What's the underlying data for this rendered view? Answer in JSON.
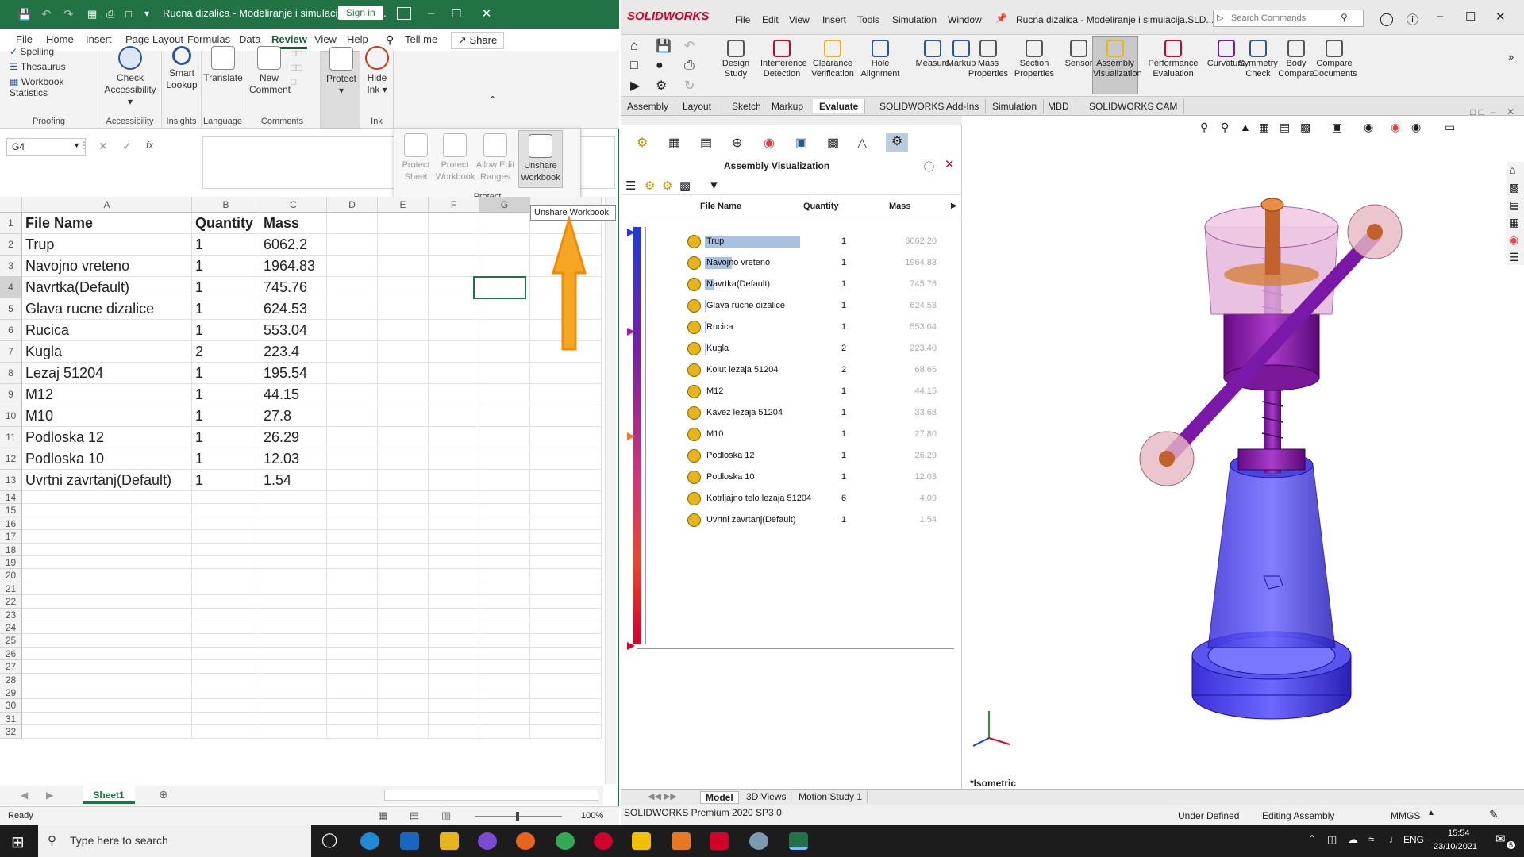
{
  "excel": {
    "title": "Ruсna dizalica - Modeliranje i simulacija_1.xlsx...",
    "signin_label": "Sign in",
    "tabs": [
      "File",
      "Home",
      "Insert",
      "Page Layout",
      "Formulas",
      "Data",
      "Review",
      "View",
      "Help"
    ],
    "tell_me": "Tell me",
    "share_label": "Share",
    "ribbon": {
      "proofing": {
        "spelling": "Spelling",
        "thesaurus": "Thesaurus",
        "stats": "Workbook Statistics",
        "group": "Proofing"
      },
      "accessibility": {
        "button": "Check Accessibility",
        "group": "Accessibility"
      },
      "insights": {
        "button": "Smart Lookup",
        "group": "Insights"
      },
      "language": {
        "button": "Translate",
        "group": "Language"
      },
      "comments": {
        "button": "New Comment",
        "group": "Comments"
      },
      "protect": {
        "button": "Protect",
        "group": "Protect"
      },
      "ink": {
        "button": "Hide Ink",
        "group": "Ink"
      }
    },
    "protect_popup": {
      "protect_sheet": "Protect Sheet",
      "protect_workbook": "Protect Workbook",
      "allow_edit": "Allow Edit Ranges",
      "unshare": "Unshare Workbook",
      "group": "Protect"
    },
    "tooltip": "Unshare Workbook",
    "namebox": "G4",
    "fx": "fx",
    "columns": [
      "A",
      "B",
      "C",
      "D",
      "E",
      "F",
      "G"
    ],
    "rows": [
      [
        "File Name",
        "Quantity",
        "Mass"
      ],
      [
        "Trup",
        "1",
        "6062.2"
      ],
      [
        "Navojno vreteno",
        "1",
        "1964.83"
      ],
      [
        "Navrtka(Default)",
        "1",
        "745.76"
      ],
      [
        "Glava rucne dizalice",
        "1",
        "624.53"
      ],
      [
        "Rucica",
        "1",
        "553.04"
      ],
      [
        "Kugla",
        "2",
        "223.4"
      ],
      [
        "Lezaj 51204",
        "1",
        "195.54"
      ],
      [
        "M12",
        "1",
        "44.15"
      ],
      [
        "M10",
        "1",
        "27.8"
      ],
      [
        "Podloska 12",
        "1",
        "26.29"
      ],
      [
        "Podloska 10",
        "1",
        "12.03"
      ],
      [
        "Uvrtni zavrtanj(Default)",
        "1",
        "1.54"
      ]
    ],
    "row_numbers": [
      "1",
      "2",
      "3",
      "4",
      "5",
      "6",
      "7",
      "8",
      "9",
      "10",
      "11",
      "12",
      "13",
      "14",
      "15",
      "16",
      "17",
      "18",
      "19",
      "20",
      "21",
      "22",
      "23",
      "24",
      "25",
      "26",
      "27",
      "28",
      "29",
      "30",
      "31",
      "32"
    ],
    "sheet_tab": "Sheet1",
    "status": "Ready",
    "zoom": "100%"
  },
  "sw": {
    "brand": "SOLIDWORKS",
    "menu": [
      "File",
      "Edit",
      "View",
      "Insert",
      "Tools",
      "Simulation",
      "Window"
    ],
    "doc_title": "Rucna dizalica - Modeliranje i simulacija.SLD...",
    "search_placeholder": "Search Commands",
    "commands": [
      "Design Study",
      "Interference Detection",
      "Clearance Verification",
      "Hole Alignment",
      "Measure",
      "Markup",
      "Mass Properties",
      "Section Properties",
      "Sensor",
      "Assembly Visualization",
      "Performance Evaluation",
      "Curvature",
      "Symmetry Check",
      "Body Compare",
      "Compare Documents"
    ],
    "tabs": [
      "Assembly",
      "Layout",
      "Sketch",
      "Markup",
      "Evaluate",
      "SOLIDWORKS Add-Ins",
      "Simulation",
      "MBD",
      "SOLIDWORKS CAM"
    ],
    "panel_title": "Assembly Visualization",
    "columns": {
      "name": "File Name",
      "qty": "Quantity",
      "mass": "Mass"
    },
    "items": [
      {
        "name": "Trup",
        "qty": "1",
        "mass": "6062.20"
      },
      {
        "name": "Navojno vreteno",
        "qty": "1",
        "mass": "1964.83"
      },
      {
        "name": "Navrtka(Default)",
        "qty": "1",
        "mass": "745.76"
      },
      {
        "name": "Glava rucne dizalice",
        "qty": "1",
        "mass": "624.53"
      },
      {
        "name": "Rucica",
        "qty": "1",
        "mass": "553.04"
      },
      {
        "name": "Kugla",
        "qty": "2",
        "mass": "223.40"
      },
      {
        "name": "Kolut lezaja 51204",
        "qty": "2",
        "mass": "68.65"
      },
      {
        "name": "M12",
        "qty": "1",
        "mass": "44.15"
      },
      {
        "name": "Kavez lezaja 51204",
        "qty": "1",
        "mass": "33.68"
      },
      {
        "name": "M10",
        "qty": "1",
        "mass": "27.80"
      },
      {
        "name": "Podloska 12",
        "qty": "1",
        "mass": "26.29"
      },
      {
        "name": "Podloska 10",
        "qty": "1",
        "mass": "12.03"
      },
      {
        "name": "Kotrljajno telo lezaja 51204",
        "qty": "6",
        "mass": "4.09"
      },
      {
        "name": "Uvrtni zavrtanj(Default)",
        "qty": "1",
        "mass": "1.54"
      }
    ],
    "view_label": "*Isometric",
    "bottom_tabs": [
      "Model",
      "3D Views",
      "Motion Study 1"
    ],
    "status_left": "SOLIDWORKS Premium 2020 SP3.0",
    "status_mid": "Under Defined",
    "status_mode": "Editing Assembly",
    "status_units": "MMGS"
  },
  "taskbar": {
    "search_placeholder": "Type here to search",
    "lang": "ENG",
    "time": "15:54",
    "date": "23/10/2021",
    "notif": "5"
  },
  "colors": {
    "excel_green": "#217346",
    "sw_red": "#d3002b",
    "highlight": "#a9c1e0",
    "purple": "#8a2be2"
  }
}
